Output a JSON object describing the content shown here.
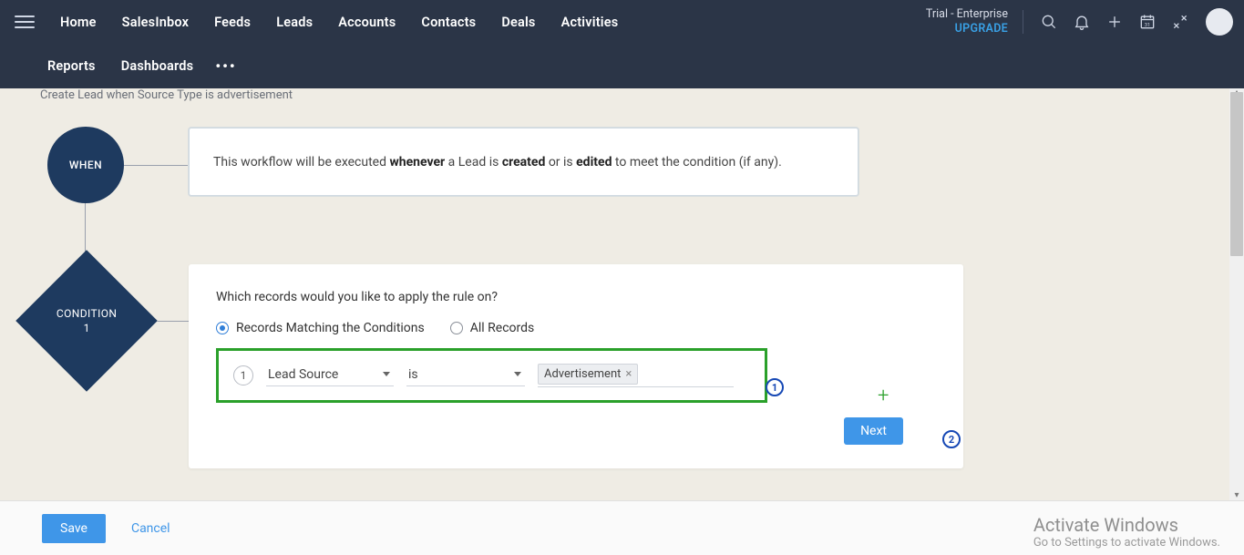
{
  "nav": {
    "items": [
      "Home",
      "SalesInbox",
      "Feeds",
      "Leads",
      "Accounts",
      "Contacts",
      "Deals",
      "Activities"
    ],
    "row2": [
      "Reports",
      "Dashboards"
    ],
    "trial": "Trial - Enterprise",
    "upgrade": "UPGRADE"
  },
  "rule": {
    "name": "Create Lead when Source Type is advertisement"
  },
  "when": {
    "node": "WHEN",
    "text_pre": "This workflow will be executed ",
    "b1": "whenever",
    "mid1": " a Lead is ",
    "b2": "created",
    "mid2": " or is ",
    "b3": "edited",
    "tail": " to meet the condition (if any)."
  },
  "cond": {
    "node_line1": "CONDITION",
    "node_line2": "1",
    "title": "Which records would you like to apply the rule on?",
    "radio1": "Records Matching the Conditions",
    "radio2": "All Records",
    "step_num": "1",
    "field": "Lead Source",
    "operator": "is",
    "value_tag": "Advertisement",
    "next": "Next",
    "annot1": "1",
    "annot2": "2"
  },
  "footer": {
    "save": "Save",
    "cancel": "Cancel"
  },
  "windows": {
    "line1": "Activate Windows",
    "line2": "Go to Settings to activate Windows."
  },
  "icons": {
    "search": "search-icon",
    "bell": "bell-icon",
    "plus": "plus-icon",
    "calendar": "calendar-icon",
    "tools": "tools-icon"
  }
}
